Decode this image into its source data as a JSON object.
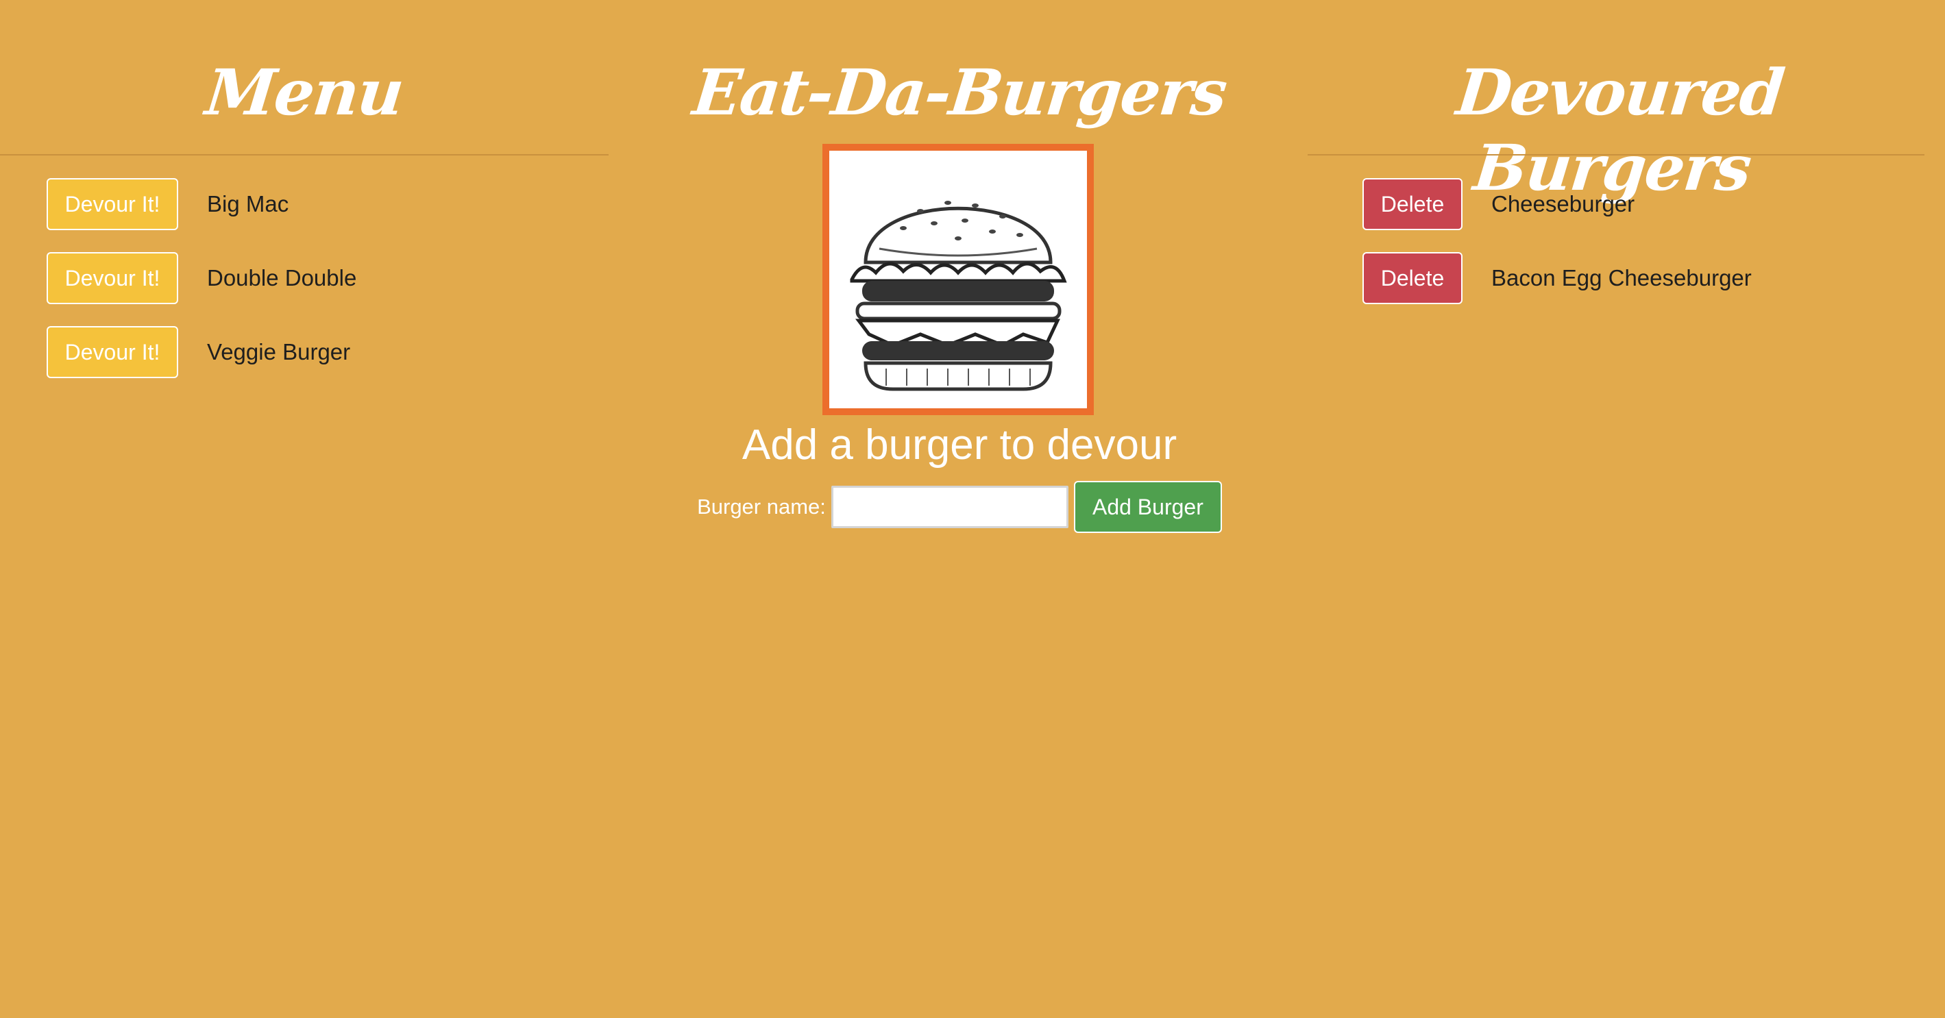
{
  "colors": {
    "background": "#E2AA4C",
    "devour_button": "#F5C23B",
    "delete_button": "#C8444F",
    "add_button": "#4FA04E",
    "image_border": "#EC6E2C"
  },
  "menu": {
    "title": "Menu",
    "items": [
      {
        "button_label": "Devour It!",
        "name": "Big Mac"
      },
      {
        "button_label": "Devour It!",
        "name": "Double Double"
      },
      {
        "button_label": "Devour It!",
        "name": "Veggie Burger"
      }
    ]
  },
  "center": {
    "title": "Eat-Da-Burgers",
    "image_icon": "burger-illustration",
    "add_heading": "Add a burger to devour",
    "form": {
      "label": "Burger name:",
      "input_value": "",
      "submit_label": "Add Burger"
    }
  },
  "devoured": {
    "title": "Devoured Burgers",
    "items": [
      {
        "button_label": "Delete",
        "name": "Cheeseburger"
      },
      {
        "button_label": "Delete",
        "name": "Bacon Egg Cheeseburger"
      }
    ]
  }
}
